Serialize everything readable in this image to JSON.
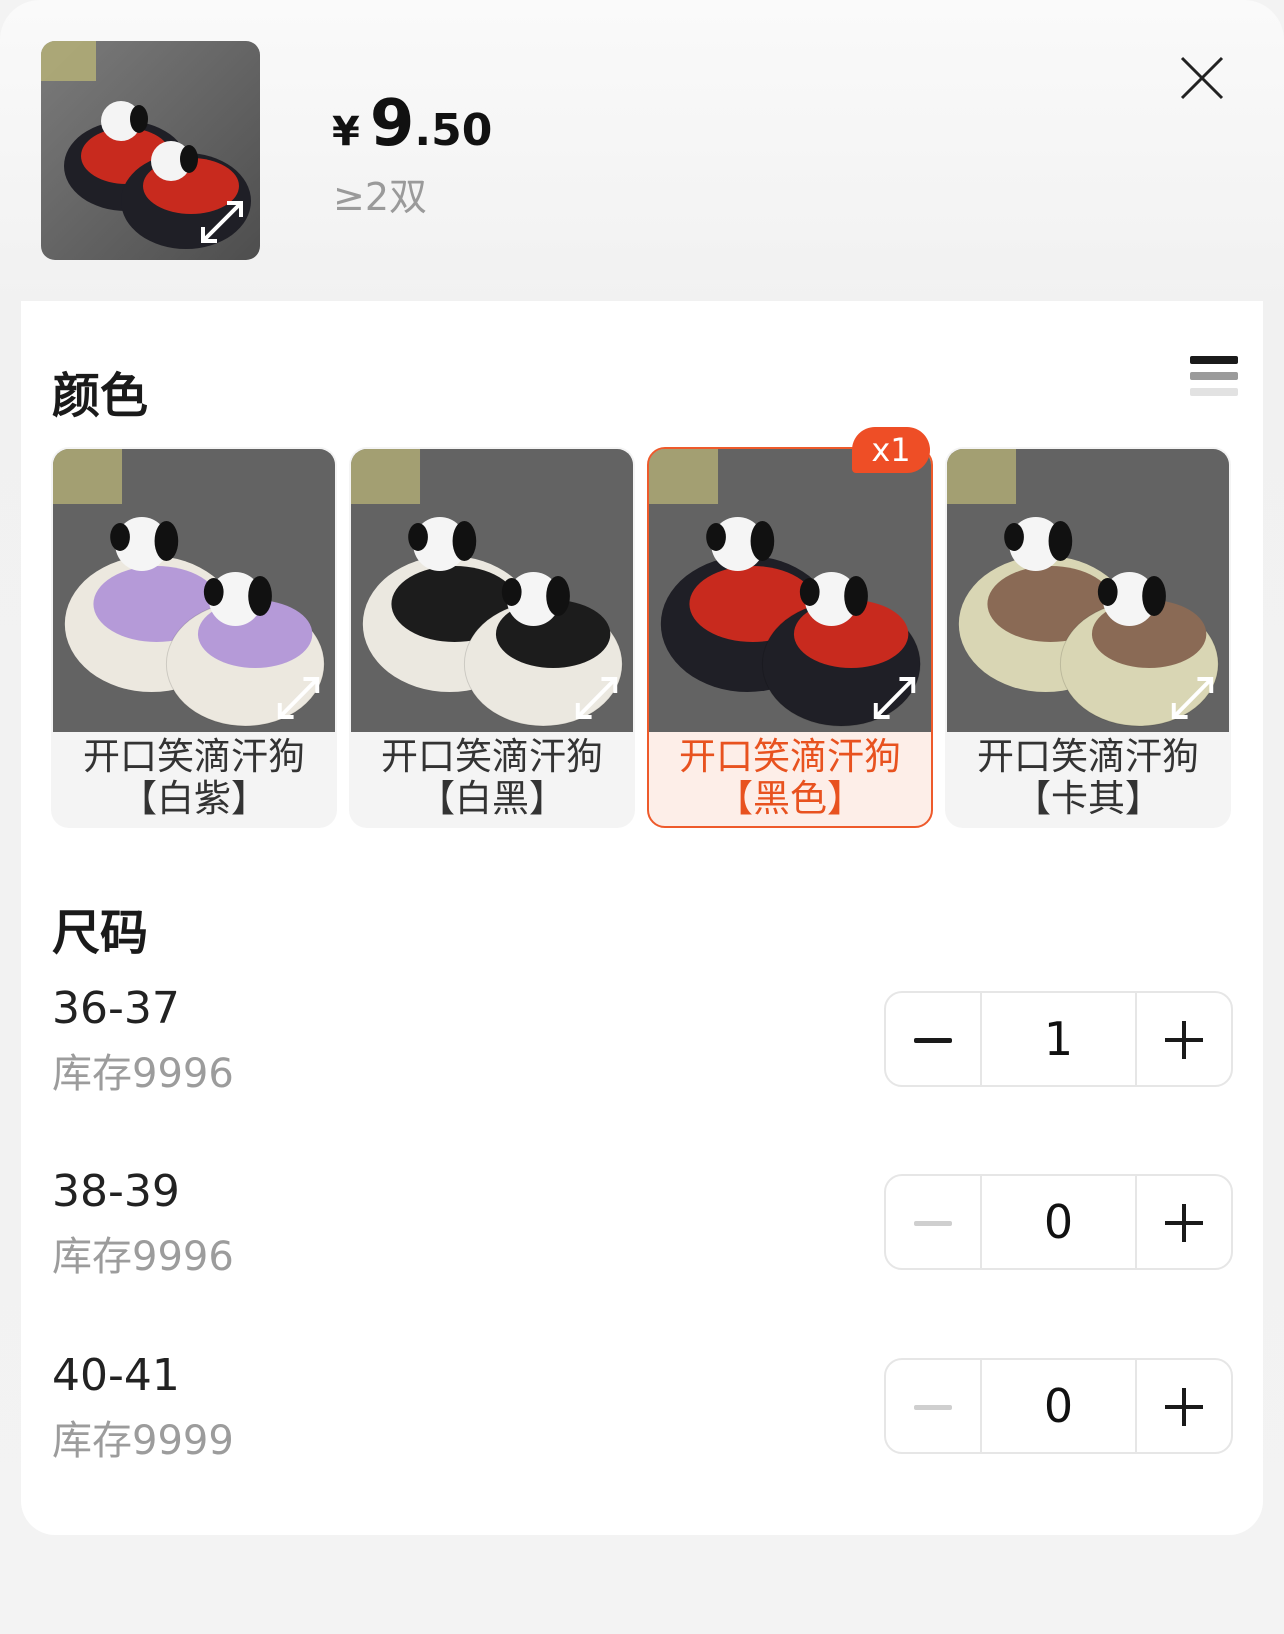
{
  "header": {
    "currency": "¥",
    "price_integer": "9",
    "price_decimal": ".50",
    "min_order": "≥2双"
  },
  "color_section": {
    "title": "颜色",
    "selected_badge": "x1",
    "options": [
      {
        "line1": "开口笑滴汗狗",
        "line2": "【白紫】",
        "shoe_color": "#ece8df",
        "lining_color": "#b59ad8"
      },
      {
        "line1": "开口笑滴汗狗",
        "line2": "【白黑】",
        "shoe_color": "#ebe8e0",
        "lining_color": "#1c1c1c"
      },
      {
        "line1": "开口笑滴汗狗",
        "line2": "【黑色】",
        "shoe_color": "#1f1f26",
        "lining_color": "#c82a1e"
      },
      {
        "line1": "开口笑滴汗狗",
        "line2": "【卡其】",
        "shoe_color": "#d9d6b4",
        "lining_color": "#8a6a55"
      }
    ]
  },
  "size_section": {
    "title": "尺码",
    "rows": [
      {
        "size": "36-37",
        "stock": "库存9996",
        "qty": "1"
      },
      {
        "size": "38-39",
        "stock": "库存9996",
        "qty": "0"
      },
      {
        "size": "40-41",
        "stock": "库存9999",
        "qty": "0"
      }
    ]
  },
  "icons": {
    "close": "close-icon",
    "expand": "expand-icon",
    "list_view": "list-view-icon",
    "minus": "minus-icon",
    "plus": "plus-icon"
  },
  "colors": {
    "accent": "#ee5a2b",
    "badge": "#ee4e26",
    "muted_text": "#9c9c9c"
  }
}
